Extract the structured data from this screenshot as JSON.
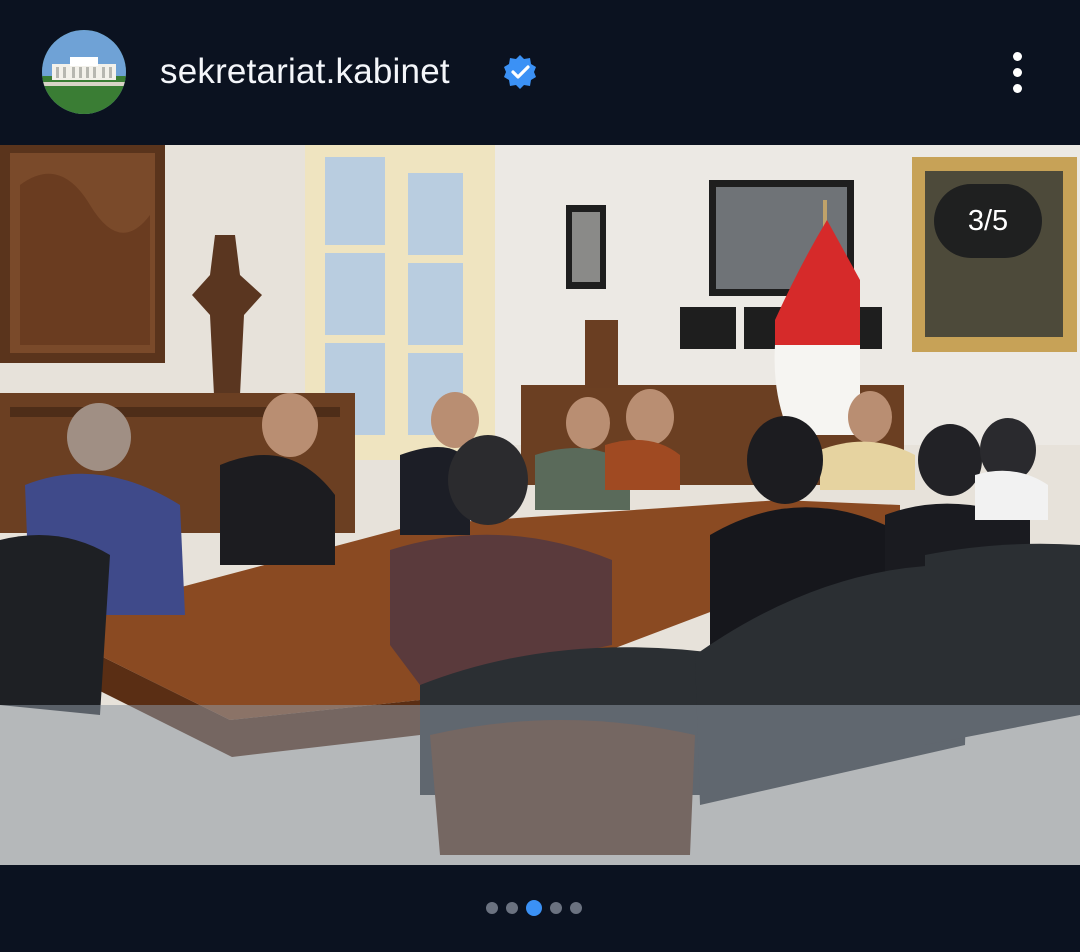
{
  "post": {
    "username": "sekretariat.kabinet",
    "verified": true,
    "more_icon": "more-vertical-icon",
    "avatar_icon": "building-avatar"
  },
  "carousel": {
    "counter": "3/5",
    "current": 3,
    "total": 5
  },
  "colors": {
    "background": "#0b1220",
    "verified_badge": "#3b91f5",
    "active_dot": "#3b91f5",
    "inactive_dot": "#6b7280"
  }
}
